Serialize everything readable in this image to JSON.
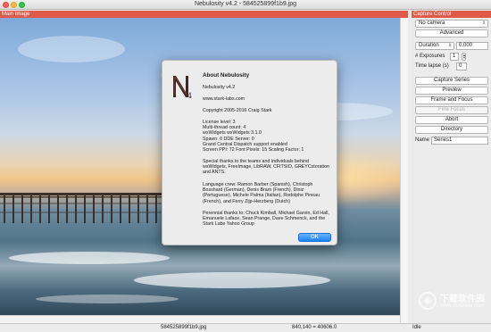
{
  "window": {
    "title": "Nebulosity v4.2 - 584525899f1b9.jpg"
  },
  "main": {
    "label": "Main Image"
  },
  "statusbar": {
    "filename": "584525899f1b9.jpg",
    "coords": "840,140 = 40606.0",
    "state": "Idle"
  },
  "capture_control": {
    "label": "Capture Control",
    "camera_select": "No camera",
    "advanced": "Advanced",
    "duration_select": "Duration",
    "duration_value": "0.000",
    "exposures_label": "# Exposures",
    "exposures_value": "1",
    "timelapse_label": "Time lapse (s)",
    "timelapse_value": "0",
    "buttons": {
      "capture_series": "Capture Series",
      "preview": "Preview",
      "frame_focus": "Frame and Focus",
      "fine_focus": "Fine Focus",
      "abort": "Abort",
      "directory": "Directory"
    },
    "name_label": "Name",
    "name_value": "Series1"
  },
  "about": {
    "title": "About Nebulosity",
    "version": "Nebulosity v4.2",
    "website": "www.stark-labs.com",
    "copyright": "Copyright 2005-2016 Craig Stark",
    "info": "License level: 3\nMulti-thread count: 4\nwxWidgets wxWidgets 3.1.0\nSpawn: 0  DDE Server: 0\nGrand Central Dispatch support enabled\nScreen PPI: 72  Font Pixels: 15  Scaling Factor: 1",
    "thanks": "Special thanks to the teams and individuals behind wxWidgets, FreeImage, LibRAW, CFITSIO, GREYCstoration and ANTS.",
    "language": "Language crew: Ramon Barber (Spanish), Christoph Bosshard (German), Denis Bram (French), Diniz (Portuguese), Michele Palma (Italian), Rodolphe Pineau (French), and Ferry Zijp-Herzberg (Dutch)",
    "perennial": "Perennial thanks to: Chuck Kimball, Michael Garvin, Ed Hall, Emanuele Laface, Sean Prange, Dave Schmenck, and the Stark Labs Yahoo Group",
    "ok": "OK"
  },
  "watermark": {
    "brand": "下载软件园",
    "url": "www.downxia.com"
  },
  "colors": {
    "panel_header": "#e05a4a",
    "ok_button": "#1a82fb"
  },
  "icons": {
    "logo": "nebulosity-n4-logo",
    "select_arrow": "chevron-updown-icon"
  }
}
